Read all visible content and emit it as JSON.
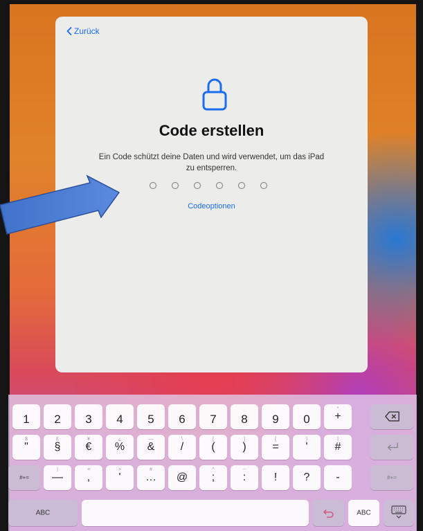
{
  "card": {
    "back_label": "Zurück",
    "title": "Code erstellen",
    "subtitle": "Ein Code schützt deine Daten und wird verwendet, um das iPad zu entsperren.",
    "passcode_digits": 6,
    "options_label": "Codeoptionen",
    "accent_color": "#1a6cf0"
  },
  "keyboard": {
    "row1": [
      "1",
      "2",
      "3",
      "4",
      "5",
      "6",
      "7",
      "8",
      "9",
      "0",
      "+"
    ],
    "row1_small": [
      "",
      "",
      "",
      "",
      "",
      "",
      "",
      "",
      "",
      "",
      "*"
    ],
    "row2": [
      "\"",
      "§",
      "€",
      "%",
      "&",
      "/",
      "(",
      ")",
      "=",
      "'",
      "#"
    ],
    "row2_small": [
      "$",
      "£",
      "¥",
      "¿",
      "—",
      "\\",
      "[",
      "]",
      "{",
      "}",
      "|"
    ],
    "row3_left": "#+=",
    "row3": [
      "—",
      ",",
      "'",
      "…",
      "@",
      ";",
      ":",
      "!",
      "?",
      "-"
    ],
    "row3_small": [
      "|",
      "<",
      ">",
      "#",
      "",
      "^",
      "~",
      "",
      "",
      ""
    ],
    "row3_right": "#+=",
    "abc_left": "ABC",
    "abc_right": "ABC",
    "icons": {
      "delete": "delete-backward-icon",
      "return": "return-icon",
      "undo": "undo-icon",
      "hide_keyboard": "keyboard-hide-icon"
    }
  }
}
